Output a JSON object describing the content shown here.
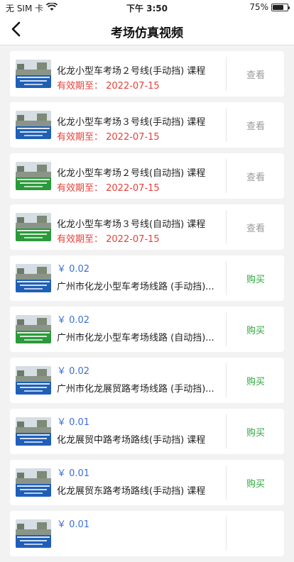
{
  "status": {
    "carrier": "无 SIM 卡",
    "time": "下午 3:50",
    "battery": "75%",
    "battery_level": 0.75
  },
  "nav": {
    "title": "考场仿真视频",
    "back_icon": "chevron-left-icon"
  },
  "items": [
    {
      "kind": "owned",
      "title": "化龙小型车考场２号线(手动挡) 课程",
      "expiry": "有效期至：  2022-07-15",
      "action": "查看",
      "banner_color": "#1f5fb8"
    },
    {
      "kind": "owned",
      "title": "化龙小型车考场３号线(手动挡) 课程",
      "expiry": "有效期至：  2022-07-15",
      "action": "查看",
      "banner_color": "#1f5fb8"
    },
    {
      "kind": "owned",
      "title": "化龙小型车考场２号线(自动挡) 课程",
      "expiry": "有效期至：  2022-07-15",
      "action": "查看",
      "banner_color": "#2a9a3a"
    },
    {
      "kind": "owned",
      "title": "化龙小型车考场３号线(自动挡) 课程",
      "expiry": "有效期至：  2022-07-15",
      "action": "查看",
      "banner_color": "#2a9a3a"
    },
    {
      "kind": "buy",
      "price": "￥ 0.02",
      "title": "广州市化龙小型车考场线路 (手动挡)...",
      "action": "购买",
      "banner_color": "#1f5fb8"
    },
    {
      "kind": "buy",
      "price": "￥ 0.02",
      "title": "广州市化龙小型车考场线路 (自动挡)...",
      "action": "购买",
      "banner_color": "#2a9a3a"
    },
    {
      "kind": "buy",
      "price": "￥ 0.02",
      "title": "广州市化龙展贸路考场线路 (手动挡)...",
      "action": "购买",
      "banner_color": "#1f5fb8"
    },
    {
      "kind": "buy",
      "price": "￥ 0.01",
      "title": "化龙展贸中路考场路线(手动挡) 课程",
      "action": "购买",
      "banner_color": "#1f5fb8"
    },
    {
      "kind": "buy",
      "price": "￥ 0.01",
      "title": "化龙展贸东路考场路线(手动挡) 课程",
      "action": "购买",
      "banner_color": "#1f5fb8"
    },
    {
      "kind": "buy",
      "price": "￥ 0.01",
      "title": "",
      "action": "",
      "banner_color": "#1f5fb8"
    }
  ]
}
